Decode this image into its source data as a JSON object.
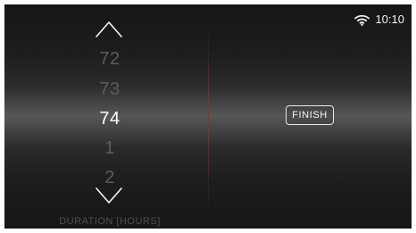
{
  "status_bar": {
    "time": "10:10",
    "wifi_icon": "wifi-icon"
  },
  "picker": {
    "up_icon": "chevron-up-icon",
    "down_icon": "chevron-down-icon",
    "items": [
      "72",
      "73",
      "74",
      "1",
      "2"
    ],
    "selected_value": "74",
    "label": "DURATION [HOURS]"
  },
  "actions": {
    "finish_label": "FINISH"
  },
  "colors": {
    "background_dark": "#161616",
    "background_highlight": "#575757",
    "text_primary": "#ffffff",
    "text_muted": "#5d5d5d",
    "divider_accent": "#9a2b2b"
  }
}
